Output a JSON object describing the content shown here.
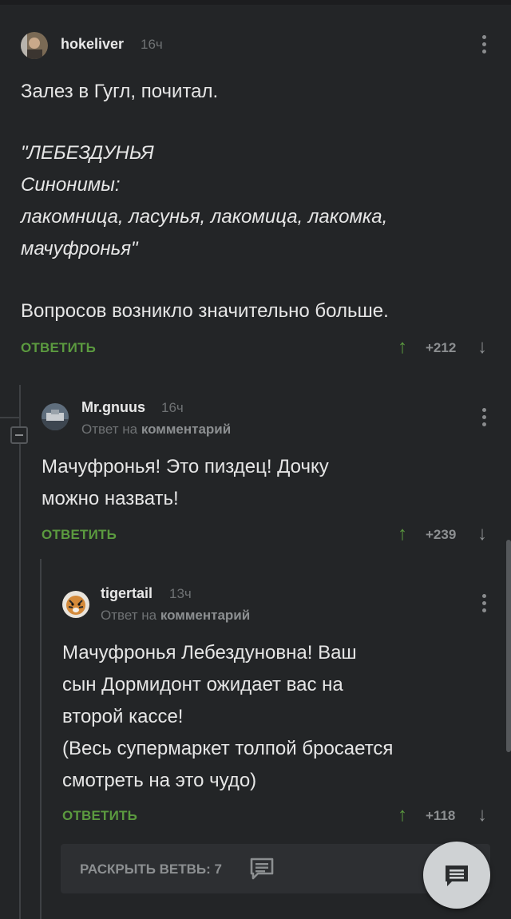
{
  "comments": [
    {
      "username": "hokeliver",
      "time": "16ч",
      "body": "Залез в Гугл, почитал.",
      "quote": "\"ЛЕБЕЗДУНЬЯ\nСинонимы:\nлакомница, ласунья, лакомица, лакомка,\nмачуфронья\"",
      "body2": "Вопросов возникло значительно больше.",
      "reply_label": "ОТВЕТИТЬ",
      "score": "+212"
    },
    {
      "username": "Mr.gnuus",
      "time": "16ч",
      "reply_to_prefix": "Ответ на",
      "reply_to_target": "комментарий",
      "body": "Мачуфронья! Это пиздец! Дочку\nможно назвать!",
      "reply_label": "ОТВЕТИТЬ",
      "score": "+239"
    },
    {
      "username": "tigertail",
      "time": "13ч",
      "reply_to_prefix": "Ответ на",
      "reply_to_target": "комментарий",
      "body": "Мачуфронья Лебездуновна!  Ваш\nсын Дормидонт ожидает вас на\nвторой кассе!\n(Весь супермаркет толпой бросается\nсмотреть на это чудо)",
      "reply_label": "ОТВЕТИТЬ",
      "score": "+118"
    }
  ],
  "expand_branch": {
    "label": "РАСКРЫТЬ ВЕТВЬ: 7",
    "icon": "comment-lines-icon"
  },
  "fab": {
    "icon": "comment-lines-icon"
  },
  "icons": {
    "vote_up": "↑",
    "vote_down": "↓"
  },
  "colors": {
    "background": "#232527",
    "accent_green": "#5b9a3f",
    "muted": "#8c8f91"
  }
}
